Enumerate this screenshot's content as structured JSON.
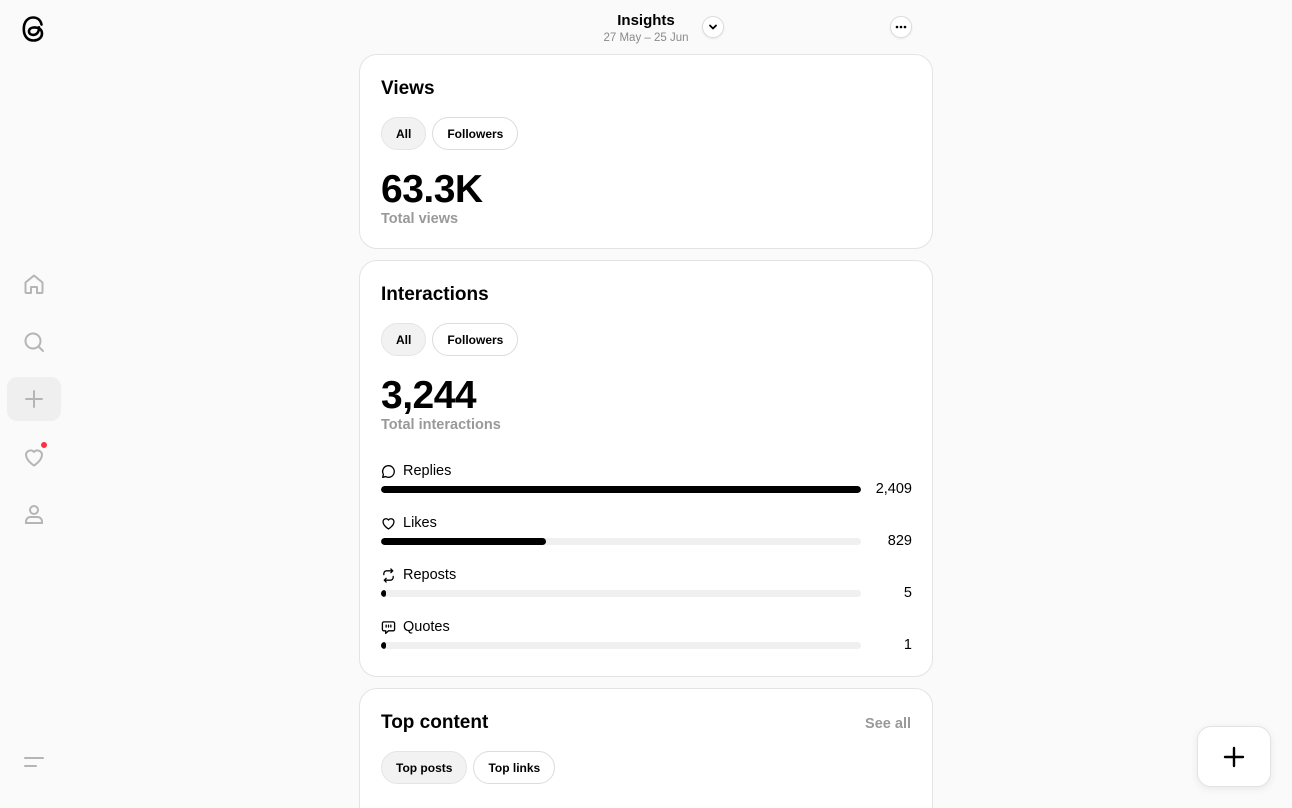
{
  "header": {
    "title": "Insights",
    "date_range": "27 May – 25 Jun",
    "dropdown_icon": "chevron-down-icon",
    "more_icon": "more-horizontal-icon"
  },
  "sidebar": {
    "logo_icon": "threads-logo-icon",
    "items": [
      {
        "name": "home",
        "icon": "home-icon"
      },
      {
        "name": "search",
        "icon": "search-icon"
      },
      {
        "name": "create",
        "icon": "plus-icon",
        "active": true
      },
      {
        "name": "activity",
        "icon": "heart-icon",
        "notification": true
      },
      {
        "name": "profile",
        "icon": "person-icon"
      }
    ],
    "menu_icon": "menu-icon"
  },
  "views": {
    "title": "Views",
    "filters": [
      "All",
      "Followers"
    ],
    "selected_filter": "All",
    "total": "63.3K",
    "total_label": "Total views"
  },
  "interactions": {
    "title": "Interactions",
    "filters": [
      "All",
      "Followers"
    ],
    "selected_filter": "All",
    "total": "3,244",
    "total_label": "Total interactions",
    "metrics": [
      {
        "label": "Replies",
        "value": "2,409",
        "fraction": 1.0,
        "icon": "reply-icon"
      },
      {
        "label": "Likes",
        "value": "829",
        "fraction": 0.344,
        "icon": "heart-icon"
      },
      {
        "label": "Reposts",
        "value": "5",
        "fraction": 0.01,
        "icon": "repost-icon"
      },
      {
        "label": "Quotes",
        "value": "1",
        "fraction": 0.01,
        "icon": "quote-icon"
      }
    ]
  },
  "top_content": {
    "title": "Top content",
    "see_all": "See all",
    "filters": [
      "Top posts",
      "Top links"
    ],
    "selected_filter": "Top posts"
  },
  "fab": {
    "icon": "plus-icon"
  }
}
